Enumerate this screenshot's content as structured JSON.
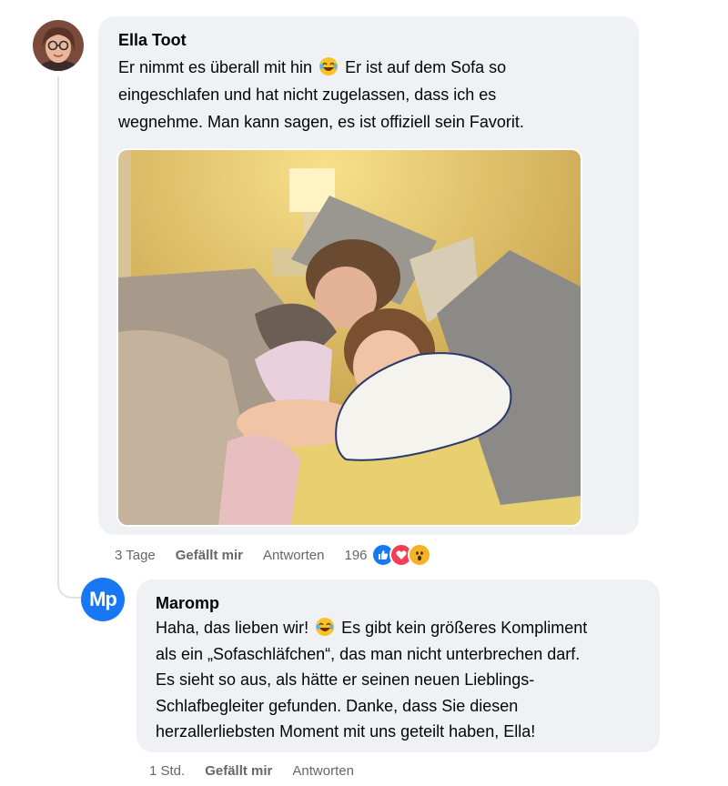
{
  "comment": {
    "author": "Ella Toot",
    "text": "Er nimmt es überall mit hin   Er ist auf dem Sofa so eingeschlafen und hat nicht zugelassen, dass ich es wegnehme. Man kann sagen, es ist offiziell sein Favorit.",
    "text_line1_a": "Er nimmt es überall mit hin",
    "text_line1_b": "Er ist auf dem Sofa so",
    "text_rest": "eingeschlafen und hat nicht zugelassen, dass ich es\nwegnehme. Man kann sagen, es ist offiziell sein Favorit.",
    "emoji": "laughing-tears-emoji",
    "image_icon": "photo-two-girls-with-pillow",
    "time": "3 Tage",
    "like_label": "Gefällt mir",
    "reply_label": "Antworten",
    "reaction_count": "196",
    "reactions": [
      "like-icon",
      "love-icon",
      "wow-icon"
    ]
  },
  "reply": {
    "author": "Maromp",
    "avatar_initials": "Mp",
    "text_line1_a": "Haha, das lieben wir!",
    "text_line1_b": "Es gibt kein größeres Kompliment",
    "text_rest": "als ein „Sofaschläfchen“, das man nicht unterbrechen darf.\nEs sieht so aus, als hätte er seinen neuen Lieblings-\nSchlafbegleiter gefunden. Danke, dass Sie diesen\nherzallerliebsten Moment mit uns geteilt haben, Ella!",
    "emoji": "laughing-tears-emoji",
    "time": "1 Std.",
    "like_label": "Gefällt mir",
    "reply_label": "Antworten"
  },
  "colors": {
    "bubble": "#eff1f4",
    "meta_text": "#65676b",
    "brand_blue": "#1877f2",
    "love_red": "#f33e58",
    "wow_yellow": "#f7b125"
  }
}
